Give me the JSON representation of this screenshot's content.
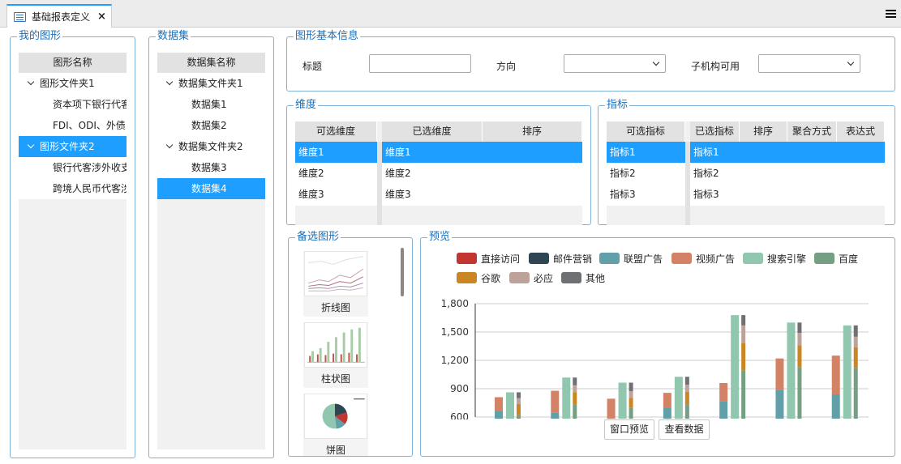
{
  "tabs": [
    {
      "label": "基础报表定义",
      "close": "×"
    }
  ],
  "my_charts": {
    "legend": "我的图形",
    "header": "图形名称",
    "items": [
      {
        "label": "图形文件夹1",
        "level": 0,
        "folder": true,
        "selected": false
      },
      {
        "label": "资本项下银行代客",
        "level": 1,
        "folder": false,
        "selected": false
      },
      {
        "label": "FDI、ODI、外债",
        "level": 1,
        "folder": false,
        "selected": false
      },
      {
        "label": "图形文件夹2",
        "level": 0,
        "folder": true,
        "selected": true
      },
      {
        "label": "银行代客涉外收支",
        "level": 1,
        "folder": false,
        "selected": false
      },
      {
        "label": "跨境人民币代客涉",
        "level": 1,
        "folder": false,
        "selected": false
      }
    ]
  },
  "datasets": {
    "legend": "数据集",
    "header": "数据集名称",
    "items": [
      {
        "label": "数据集文件夹1",
        "level": 0,
        "folder": true,
        "selected": false
      },
      {
        "label": "数据集1",
        "level": 1,
        "folder": false,
        "selected": false
      },
      {
        "label": "数据集2",
        "level": 1,
        "folder": false,
        "selected": false
      },
      {
        "label": "数据集文件夹2",
        "level": 0,
        "folder": true,
        "selected": false
      },
      {
        "label": "数据集3",
        "level": 1,
        "folder": false,
        "selected": false
      },
      {
        "label": "数据集4",
        "level": 1,
        "folder": false,
        "selected": true
      }
    ]
  },
  "basic_info": {
    "legend": "图形基本信息",
    "title_label": "标题",
    "title_value": "",
    "direction_label": "方向",
    "direction_value": "",
    "child_org_label": "子机构可用",
    "child_org_value": ""
  },
  "dimensions": {
    "legend": "维度",
    "available_header": "可选维度",
    "selected_header": "已选维度",
    "sort_header": "排序",
    "available": [
      "维度1",
      "维度2",
      "维度3"
    ],
    "selected": [
      "维度1",
      "维度2",
      "维度3"
    ]
  },
  "metrics": {
    "legend": "指标",
    "available_header": "可选指标",
    "selected_header": "已选指标",
    "sort_header": "排序",
    "agg_header": "聚合方式",
    "expr_header": "表达式",
    "available": [
      "指标1",
      "指标2",
      "指标3"
    ],
    "selected": [
      "指标1",
      "指标2",
      "指标3"
    ]
  },
  "candidate_charts": {
    "legend": "备选图形",
    "items": [
      {
        "label": "折线图",
        "icon": "line-chart-thumbnail"
      },
      {
        "label": "柱状图",
        "icon": "bar-chart-thumbnail"
      },
      {
        "label": "饼图",
        "icon": "pie-chart-thumbnail"
      }
    ]
  },
  "preview": {
    "legend": "预览",
    "preview_button": "窗口预览",
    "view_data_button": "查看数据"
  },
  "chart_data": {
    "type": "bar",
    "title": "",
    "ylim": [
      600,
      1800
    ],
    "yticks": [
      "600",
      "900",
      "1,200",
      "1,500",
      "1,800"
    ],
    "grid": true,
    "legend_position": "top",
    "colors": {
      "直接访问": "#c23531",
      "邮件营销": "#2f4554",
      "联盟广告": "#61a0a8",
      "视频广告": "#d48265",
      "搜索引擎": "#91c7ae",
      "百度": "#749f83",
      "谷歌": "#ca8622",
      "必应": "#bda29a",
      "其他": "#6e7074"
    },
    "series": [
      {
        "name": "直接访问",
        "values": [
          320,
          332,
          301,
          334,
          390,
          330,
          320
        ]
      },
      {
        "name": "邮件营销",
        "values": [
          120,
          132,
          101,
          134,
          90,
          230,
          210
        ]
      },
      {
        "name": "联盟广告",
        "values": [
          220,
          182,
          191,
          234,
          290,
          330,
          310
        ]
      },
      {
        "name": "视频广告",
        "values": [
          150,
          232,
          201,
          154,
          190,
          330,
          410
        ]
      },
      {
        "name": "搜索引擎",
        "values": [
          862,
          1018,
          964,
          1026,
          1679,
          1600,
          1570
        ]
      },
      {
        "name": "百度",
        "values": [
          620,
          732,
          701,
          734,
          1090,
          1130,
          1120
        ]
      },
      {
        "name": "谷歌",
        "values": [
          120,
          132,
          101,
          134,
          290,
          230,
          220
        ]
      },
      {
        "name": "必应",
        "values": [
          60,
          72,
          71,
          74,
          190,
          130,
          110
        ]
      },
      {
        "name": "其他",
        "values": [
          62,
          82,
          91,
          84,
          109,
          110,
          120
        ]
      }
    ]
  }
}
